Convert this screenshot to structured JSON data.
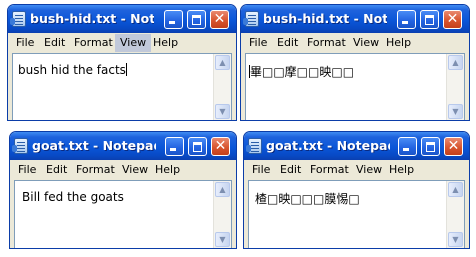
{
  "windows": [
    {
      "title": "bush-hid.txt - Not...",
      "menu": [
        "File",
        "Edit",
        "Format",
        "View",
        "Help"
      ],
      "highlighted_menu": "View",
      "content": "bush hid the facts",
      "has_cursor": true
    },
    {
      "title": "bush-hid.txt - Not...",
      "menu": [
        "File",
        "Edit",
        "Format",
        "View",
        "Help"
      ],
      "highlighted_menu": "",
      "content": "畢□□摩□□映□□",
      "has_cursor": true
    },
    {
      "title": "goat.txt - Notepad",
      "menu": [
        "File",
        "Edit",
        "Format",
        "View",
        "Help"
      ],
      "highlighted_menu": "",
      "content": "Bill fed the goats",
      "has_cursor": false
    },
    {
      "title": "goat.txt - Notepad",
      "menu": [
        "File",
        "Edit",
        "Format",
        "View",
        "Help"
      ],
      "highlighted_menu": "",
      "content": "楂□映□□□膜惕□",
      "has_cursor": false
    }
  ],
  "buttons": {
    "close_glyph": "✕"
  },
  "scroll": {
    "up_glyph": "▲",
    "down_glyph": "▼"
  },
  "colors": {
    "title_gradient_top": "#3f8cf3",
    "title_gradient_bottom": "#0a3fb0",
    "window_body": "#ece9d8",
    "close_button": "#d8552f"
  }
}
